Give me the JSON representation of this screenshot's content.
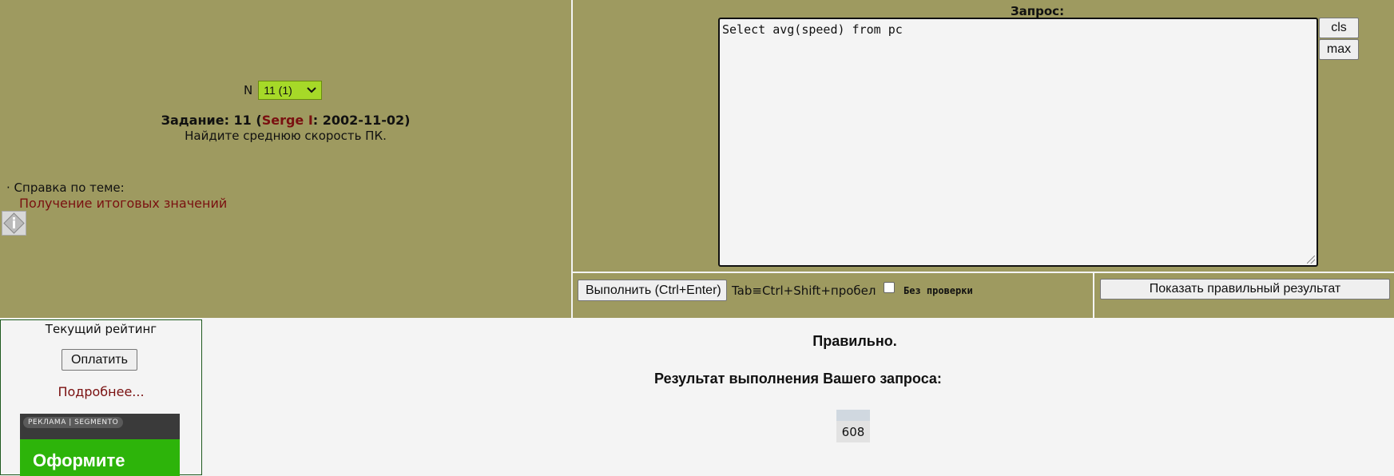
{
  "task": {
    "n_label": "N",
    "selected": "11 (1)",
    "prefix": "Задание: 11 (",
    "author": "Serge I",
    "date_suffix": ": 2002-11-02)",
    "description": "Найдите среднюю скорость ПК.",
    "help_label": "· Справка по теме:",
    "help_link": "Получение итоговых значений"
  },
  "query": {
    "label": "Запрос:",
    "text": "Select avg(speed) from pc",
    "cls_label": "cls",
    "max_label": "max"
  },
  "controls": {
    "execute_label": "Выполнить (Ctrl+Enter)",
    "tab_hint": "Tab≡Ctrl+Shift+пробел",
    "no_check_label": "Без проверки",
    "no_check_checked": false,
    "show_correct_label": "Показать правильный результат"
  },
  "rating": {
    "title": "Текущий рейтинг",
    "pay_label": "Оплатить",
    "more_link": "Подробнее...",
    "ad_badge": "РЕКЛАМА | SEGMENTO",
    "ad_text": "Оформите"
  },
  "result": {
    "status": "Правильно.",
    "title": "Результат выполнения Вашего запроса:",
    "header": "",
    "value": "608"
  },
  "icons": {
    "info": "info-icon",
    "dropdown": "chevron-down-icon"
  },
  "colors": {
    "panel_bg": "#9e9a60",
    "select_bg": "#a6d928",
    "link": "#7a1010",
    "ad_green": "#2db40a"
  }
}
